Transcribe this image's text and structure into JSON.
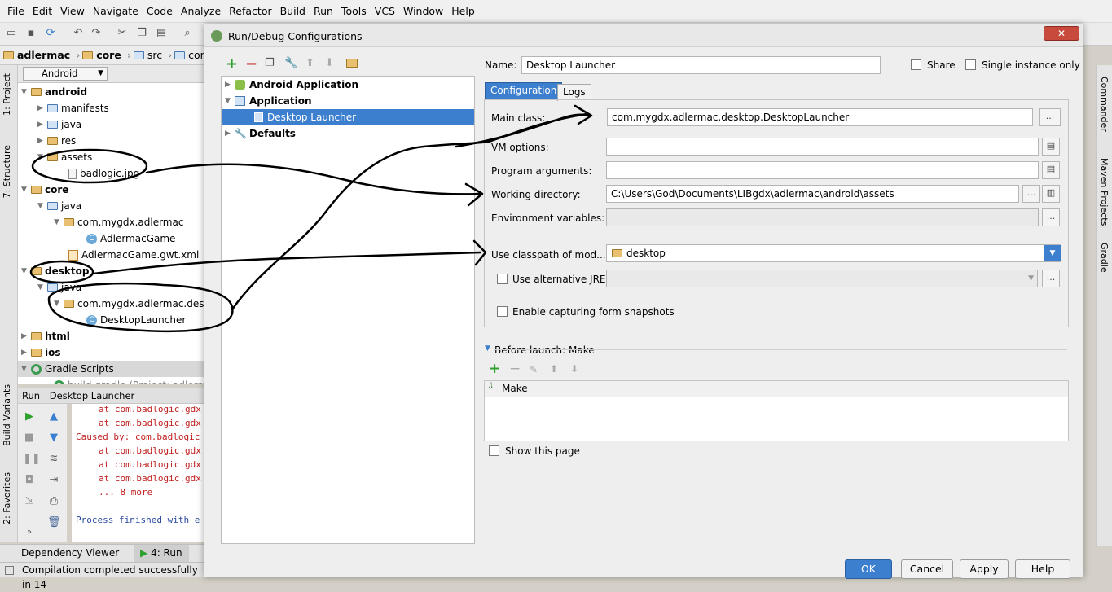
{
  "menu": [
    "File",
    "Edit",
    "View",
    "Navigate",
    "Code",
    "Analyze",
    "Refactor",
    "Build",
    "Run",
    "Tools",
    "VCS",
    "Window",
    "Help"
  ],
  "breadcrumb": [
    "adlermac",
    "core",
    "src",
    "com"
  ],
  "left_tool_tabs": [
    "1: Project",
    "7: Structure",
    "Build Variants",
    "2: Favorites"
  ],
  "right_tool_tabs": [
    "Commander",
    "Maven Projects",
    "Gradle"
  ],
  "project_view": {
    "selector": "Android"
  },
  "tree": [
    {
      "label": "android",
      "bold": true
    },
    {
      "label": "manifests"
    },
    {
      "label": "java"
    },
    {
      "label": "res"
    },
    {
      "label": "assets"
    },
    {
      "label": "badlogic.jpg"
    },
    {
      "label": "core",
      "bold": true
    },
    {
      "label": "java"
    },
    {
      "label": "com.mygdx.adlermac"
    },
    {
      "label": "AdlermacGame"
    },
    {
      "label": "AdlermacGame.gwt.xml"
    },
    {
      "label": "desktop",
      "bold": true
    },
    {
      "label": "java"
    },
    {
      "label": "com.mygdx.adlermac.deskt"
    },
    {
      "label": "DesktopLauncher"
    },
    {
      "label": "html",
      "bold": true
    },
    {
      "label": "ios",
      "bold": true
    },
    {
      "label": "Gradle Scripts"
    },
    {
      "label": "build.gradle (Project: adlermac)"
    }
  ],
  "run_panel": {
    "title": "Run",
    "config": "Desktop Launcher",
    "console": [
      "at com.badlogic.gdx",
      "at com.badlogic.gdx",
      "Caused by: com.badlogic",
      "at com.badlogic.gdx",
      "at com.badlogic.gdx",
      "at com.badlogic.gdx",
      "... 8 more",
      "Process finished with e"
    ]
  },
  "bottom_tabs": [
    "Dependency Viewer",
    "4: Run"
  ],
  "status": "Compilation completed successfully in 14",
  "dialog": {
    "title": "Run/Debug Configurations",
    "tree": [
      {
        "label": "Android Application",
        "bold": true
      },
      {
        "label": "Application",
        "bold": true
      },
      {
        "label": "Desktop Launcher",
        "selected": true
      },
      {
        "label": "Defaults",
        "bold": true
      }
    ],
    "name_label": "Name:",
    "name_value": "Desktop Launcher",
    "share_label": "Share",
    "single_instance_label": "Single instance only",
    "tabs": [
      "Configuration",
      "Logs"
    ],
    "main_class_label": "Main class:",
    "main_class_value": "com.mygdx.adlermac.desktop.DesktopLauncher",
    "vm_options_label": "VM options:",
    "program_arguments_label": "Program arguments:",
    "working_directory_label": "Working directory:",
    "working_directory_value": "C:\\Users\\God\\Documents\\LIBgdx\\adlermac\\android\\assets",
    "env_vars_label": "Environment variables:",
    "classpath_label": "Use classpath of mod...",
    "classpath_value": "desktop",
    "alt_jre_label": "Use alternative JRE:",
    "form_snapshots_label": "Enable capturing form snapshots",
    "before_launch_label": "Before launch: Make",
    "before_launch_items": [
      "Make"
    ],
    "show_page_label": "Show this page",
    "buttons": {
      "ok": "OK",
      "cancel": "Cancel",
      "apply": "Apply",
      "help": "Help"
    },
    "ellipsis": "..."
  },
  "colors": {
    "selection": "#3d7fcf",
    "annotation_ink": "#000000",
    "close": "#c84a3c"
  }
}
